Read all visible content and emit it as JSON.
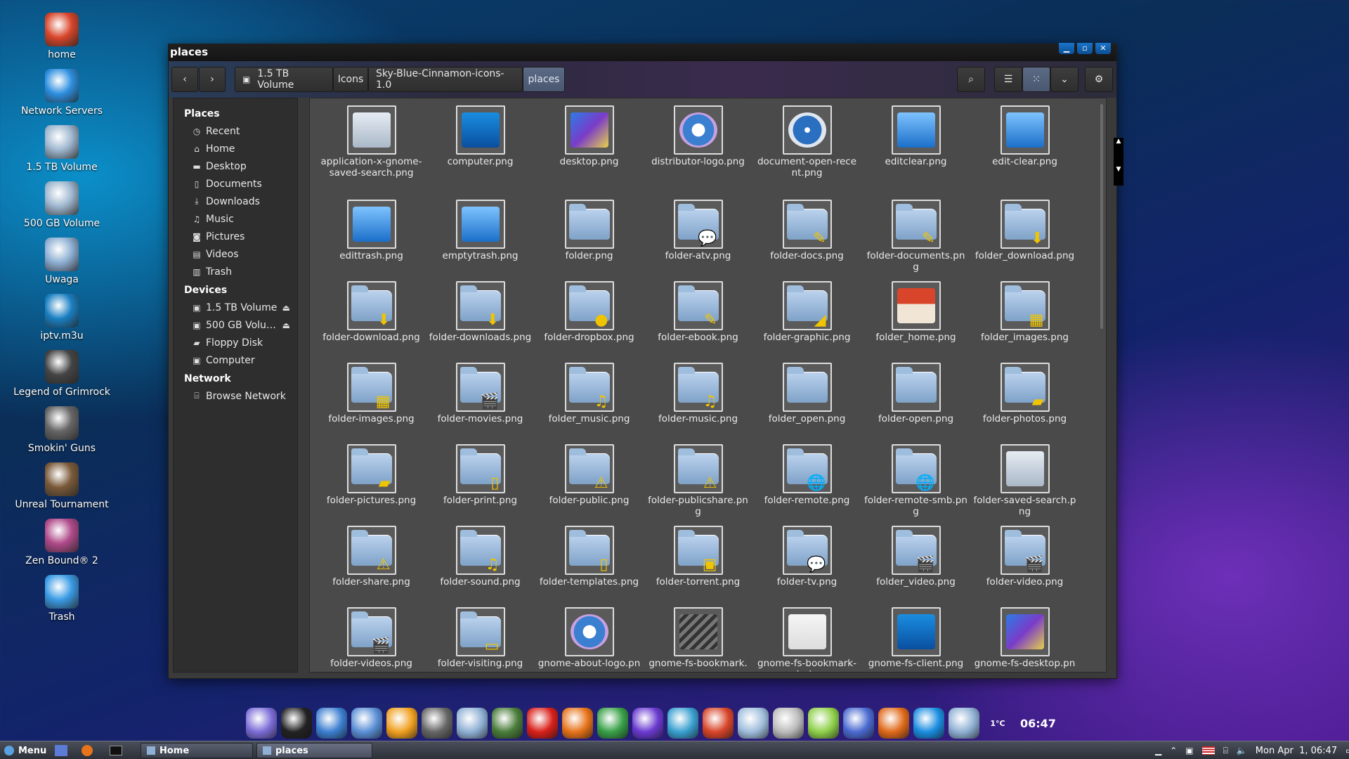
{
  "desktop": {
    "icons": [
      {
        "label": "home",
        "icon": "home-icon",
        "color": "#d8452a"
      },
      {
        "label": "Network Servers",
        "icon": "globe-icon",
        "color": "#2d8fe0"
      },
      {
        "label": "1.5 TB Volume",
        "icon": "drive-icon",
        "color": "#9fb7cf"
      },
      {
        "label": "500 GB Volume",
        "icon": "drive-icon",
        "color": "#9fb7cf"
      },
      {
        "label": "Uwaga",
        "icon": "gear-folder-icon",
        "color": "#8fb0d4"
      },
      {
        "label": "iptv.m3u",
        "icon": "playlist-icon",
        "color": "#1a7fc2"
      },
      {
        "label": "Legend of Grimrock",
        "icon": "game-icon",
        "color": "#444444"
      },
      {
        "label": "Smokin' Guns",
        "icon": "pistols-icon",
        "color": "#666666"
      },
      {
        "label": "Unreal Tournament",
        "icon": "game-icon",
        "color": "#7a5a3a"
      },
      {
        "label": "Zen Bound® 2",
        "icon": "game-icon",
        "color": "#b04a8a"
      },
      {
        "label": "Trash",
        "icon": "trash-icon",
        "color": "#3a9be5"
      }
    ]
  },
  "window": {
    "title": "places",
    "controls": {
      "minimize": "▁",
      "maximize": "▫",
      "close": "✕"
    },
    "breadcrumbs": [
      "1.5 TB Volume",
      "Icons",
      "Sky-Blue-Cinnamon-icons-1.0",
      "places"
    ]
  },
  "sidebar": {
    "places_title": "Places",
    "places": [
      {
        "label": "Recent",
        "icon": "clock-icon",
        "glyph": "◷"
      },
      {
        "label": "Home",
        "icon": "home-icon",
        "glyph": "⌂"
      },
      {
        "label": "Desktop",
        "icon": "folder-icon",
        "glyph": "▬"
      },
      {
        "label": "Documents",
        "icon": "document-icon",
        "glyph": "▯"
      },
      {
        "label": "Downloads",
        "icon": "download-icon",
        "glyph": "⤓"
      },
      {
        "label": "Music",
        "icon": "music-icon",
        "glyph": "♫"
      },
      {
        "label": "Pictures",
        "icon": "camera-icon",
        "glyph": "◙"
      },
      {
        "label": "Videos",
        "icon": "film-icon",
        "glyph": "▤"
      },
      {
        "label": "Trash",
        "icon": "trash-icon",
        "glyph": "▥"
      }
    ],
    "devices_title": "Devices",
    "devices": [
      {
        "label": "1.5 TB Volume",
        "icon": "drive-icon",
        "glyph": "▣",
        "eject": "⏏"
      },
      {
        "label": "500 GB Volu…",
        "icon": "drive-icon",
        "glyph": "▣",
        "eject": "⏏"
      },
      {
        "label": "Floppy Disk",
        "icon": "floppy-icon",
        "glyph": "▰",
        "eject": ""
      },
      {
        "label": "Computer",
        "icon": "drive-icon",
        "glyph": "▣",
        "eject": ""
      }
    ],
    "network_title": "Network",
    "network": [
      {
        "label": "Browse Network",
        "icon": "network-icon",
        "glyph": "⌸"
      }
    ]
  },
  "files": [
    {
      "name": "application-x-gnome-saved-search.png",
      "kind": "scroll"
    },
    {
      "name": "computer.png",
      "kind": "monitor"
    },
    {
      "name": "desktop.png",
      "kind": "desktop"
    },
    {
      "name": "distributor-logo.png",
      "kind": "logo"
    },
    {
      "name": "document-open-recent.png",
      "kind": "clock"
    },
    {
      "name": "editclear.png",
      "kind": "trash"
    },
    {
      "name": "edit-clear.png",
      "kind": "trash"
    },
    {
      "name": "edittrash.png",
      "kind": "trash"
    },
    {
      "name": "emptytrash.png",
      "kind": "trash"
    },
    {
      "name": "folder.png",
      "kind": "folder"
    },
    {
      "name": "folder-atv.png",
      "kind": "folder",
      "emblem": "💬"
    },
    {
      "name": "folder-docs.png",
      "kind": "folder",
      "emblem": "✎"
    },
    {
      "name": "folder-documents.png",
      "kind": "folder",
      "emblem": "✎"
    },
    {
      "name": "folder_download.png",
      "kind": "folder",
      "emblem": "⬇"
    },
    {
      "name": "folder-download.png",
      "kind": "folder",
      "emblem": "⬇"
    },
    {
      "name": "folder-downloads.png",
      "kind": "folder",
      "emblem": "⬇"
    },
    {
      "name": "folder-dropbox.png",
      "kind": "folder",
      "emblem": "●"
    },
    {
      "name": "folder-ebook.png",
      "kind": "folder",
      "emblem": "✎"
    },
    {
      "name": "folder-graphic.png",
      "kind": "folder",
      "emblem": "◢"
    },
    {
      "name": "folder_home.png",
      "kind": "home"
    },
    {
      "name": "folder_images.png",
      "kind": "folder",
      "emblem": "▦"
    },
    {
      "name": "folder-images.png",
      "kind": "folder",
      "emblem": "▦"
    },
    {
      "name": "folder-movies.png",
      "kind": "folder",
      "emblem": "🎬"
    },
    {
      "name": "folder_music.png",
      "kind": "folder",
      "emblem": "♫"
    },
    {
      "name": "folder-music.png",
      "kind": "folder",
      "emblem": "♫"
    },
    {
      "name": "folder_open.png",
      "kind": "folder"
    },
    {
      "name": "folder-open.png",
      "kind": "folder"
    },
    {
      "name": "folder-photos.png",
      "kind": "folder",
      "emblem": "▰"
    },
    {
      "name": "folder-pictures.png",
      "kind": "folder",
      "emblem": "▰"
    },
    {
      "name": "folder-print.png",
      "kind": "folder",
      "emblem": "▯"
    },
    {
      "name": "folder-public.png",
      "kind": "folder",
      "emblem": "⚠"
    },
    {
      "name": "folder-publicshare.png",
      "kind": "folder",
      "emblem": "⚠"
    },
    {
      "name": "folder-remote.png",
      "kind": "folder",
      "emblem": "🌐"
    },
    {
      "name": "folder-remote-smb.png",
      "kind": "folder",
      "emblem": "🌐"
    },
    {
      "name": "folder-saved-search.png",
      "kind": "scroll"
    },
    {
      "name": "folder-share.png",
      "kind": "folder",
      "emblem": "⚠"
    },
    {
      "name": "folder-sound.png",
      "kind": "folder",
      "emblem": "♫"
    },
    {
      "name": "folder-templates.png",
      "kind": "folder",
      "emblem": "▯"
    },
    {
      "name": "folder-torrent.png",
      "kind": "folder",
      "emblem": "▣"
    },
    {
      "name": "folder-tv.png",
      "kind": "folder",
      "emblem": "💬"
    },
    {
      "name": "folder_video.png",
      "kind": "folder",
      "emblem": "🎬"
    },
    {
      "name": "folder-video.png",
      "kind": "folder",
      "emblem": "🎬"
    },
    {
      "name": "folder-videos.png",
      "kind": "folder",
      "emblem": "🎬"
    },
    {
      "name": "folder-visiting.png",
      "kind": "folder",
      "emblem": "▭"
    },
    {
      "name": "gnome-about-logo.png",
      "kind": "logo"
    },
    {
      "name": "gnome-fs-bookmark.png",
      "kind": "bookmark"
    },
    {
      "name": "gnome-fs-bookmark-missing.",
      "kind": "book"
    },
    {
      "name": "gnome-fs-client.png",
      "kind": "monitor"
    },
    {
      "name": "gnome-fs-desktop.png",
      "kind": "desktop"
    }
  ],
  "dock": {
    "clock": "06:47",
    "weather": "1°C",
    "apps": [
      "distributor-logo-icon",
      "terminal-icon",
      "network-icon",
      "photos-icon",
      "settings-icon",
      "gimp-icon",
      "files-icon",
      "contacts-icon",
      "opera-icon",
      "firefox-icon",
      "chrome-icon",
      "emacs-icon",
      "tools-icon",
      "home-icon",
      "docs-icon",
      "search-icon",
      "download-icon",
      "desktop-icon",
      "burn-icon",
      "accessibility-icon",
      "folder-icon"
    ]
  },
  "panel": {
    "menu_label": "Menu",
    "tasks": [
      "Home",
      "places"
    ],
    "datetime": "Mon Apr  1, 06:47"
  }
}
